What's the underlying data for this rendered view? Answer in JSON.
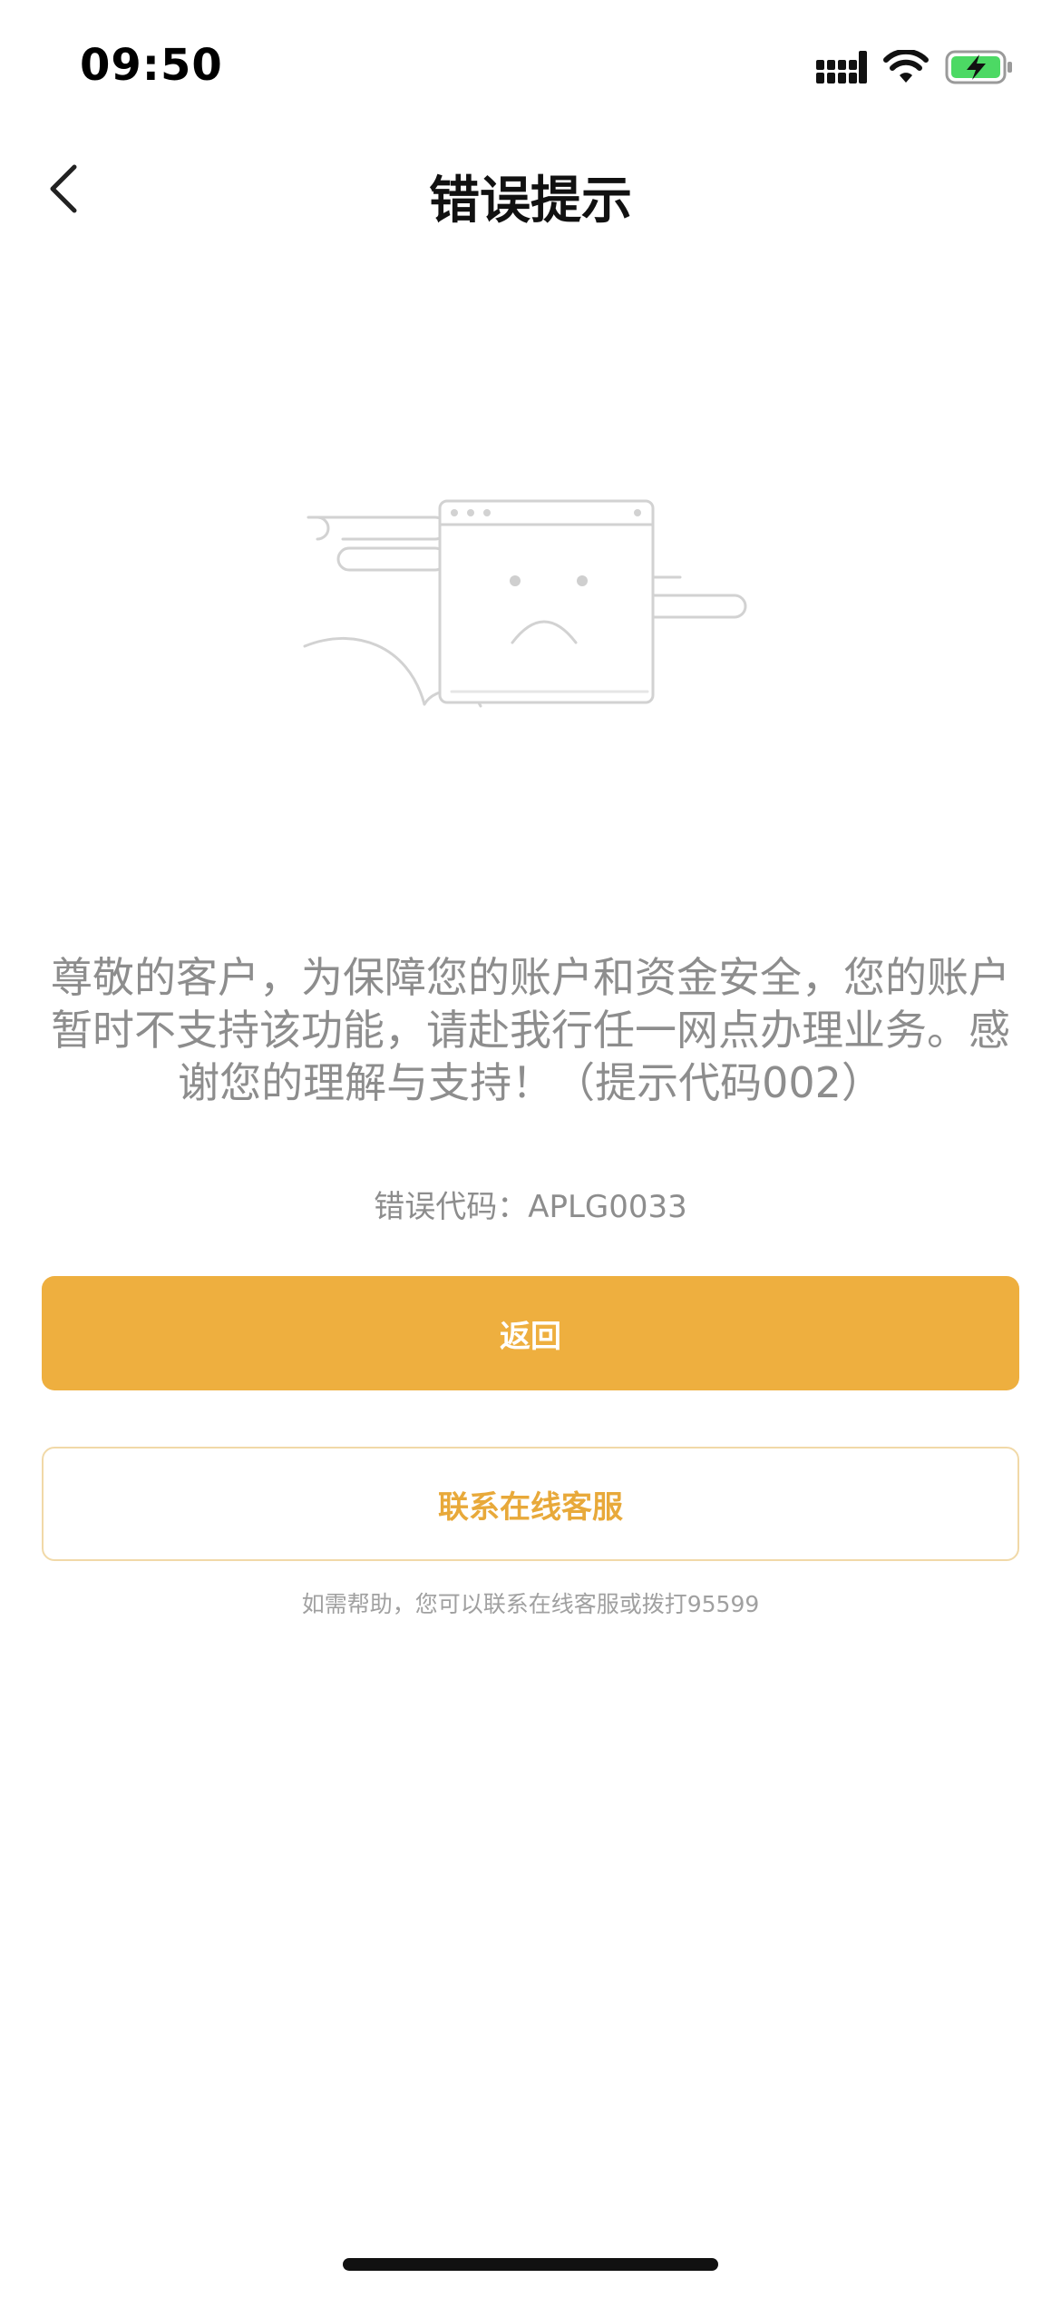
{
  "status_bar": {
    "time": "09:50",
    "icons": [
      "signal-icon",
      "wifi-icon",
      "battery-charging-icon"
    ],
    "battery_color": "#4cd964"
  },
  "nav": {
    "title": "错误提示",
    "back_icon": "chevron-left-icon"
  },
  "illustration": {
    "name": "error-browser-sad-face"
  },
  "message": {
    "line1": "尊敬的客户，为保障您的账户和资金安全，您的账户",
    "line2": "暂时不支持该功能，请赴我行任一网点办理业务。感",
    "line3": "谢您的理解与支持！（提示代码002）"
  },
  "error_code": "错误代码：APLG0033",
  "buttons": {
    "return_label": "返回",
    "service_label": "联系在线客服"
  },
  "help_text": "如需帮助，您可以联系在线客服或拨打95599",
  "colors": {
    "accent": "#eeaf3f",
    "accent_text": "#e8a93a",
    "muted_text": "#8d8d8d"
  }
}
